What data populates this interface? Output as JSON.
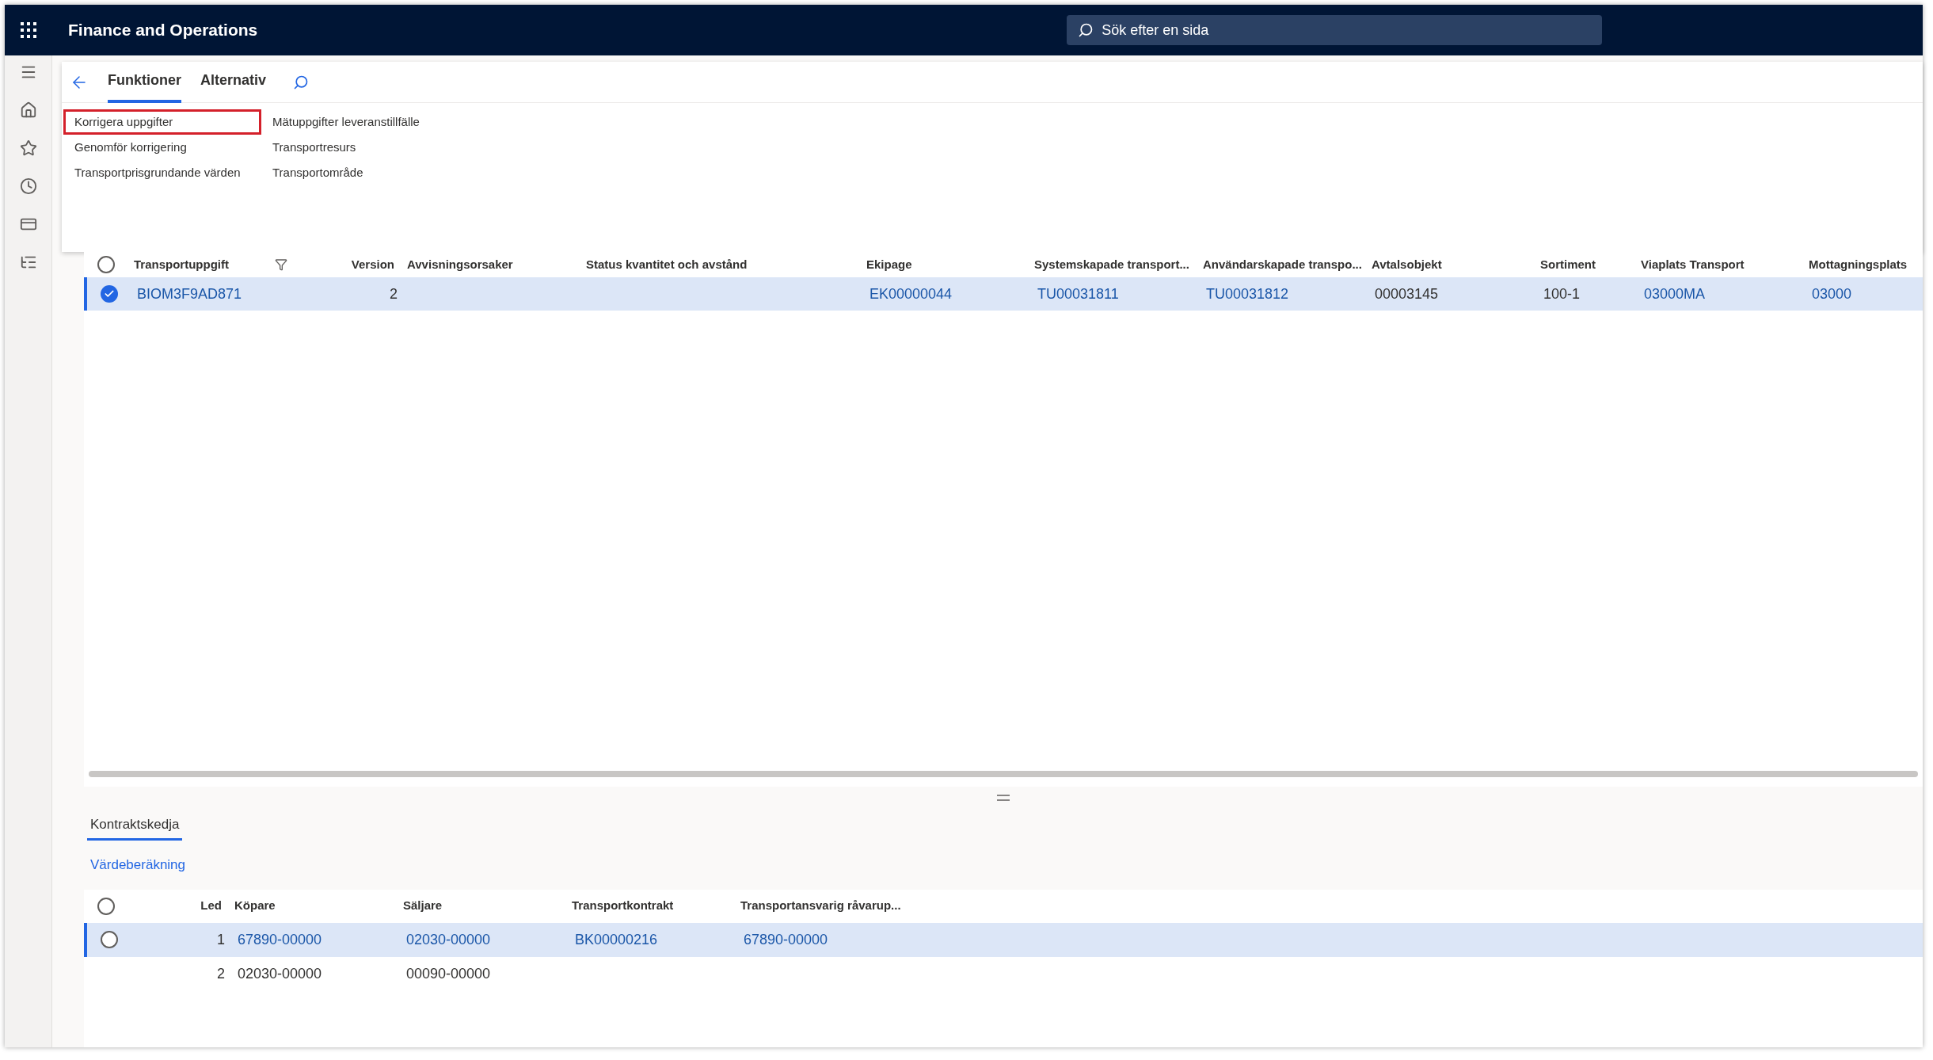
{
  "app": {
    "title": "Finance and Operations",
    "search": {
      "placeholder": "Sök efter en sida"
    }
  },
  "action_pane": {
    "tabs": [
      {
        "label": "Funktioner",
        "selected": true
      },
      {
        "label": "Alternativ",
        "selected": false
      }
    ],
    "groups": [
      [
        {
          "label": "Korrigera uppgifter",
          "highlighted": true
        },
        {
          "label": "Genomför korrigering",
          "highlighted": false
        },
        {
          "label": "Transportprisgrundande värden",
          "highlighted": false
        }
      ],
      [
        {
          "label": "Mätuppgifter leveranstillfälle",
          "highlighted": false
        },
        {
          "label": "Transportresurs",
          "highlighted": false
        },
        {
          "label": "Transportområde",
          "highlighted": false
        }
      ]
    ]
  },
  "grid": {
    "columns": [
      {
        "label": "Transportuppgift",
        "filtered": true
      },
      {
        "label": "Version",
        "filtered": false
      },
      {
        "label": "Avvisningsorsaker",
        "filtered": false
      },
      {
        "label": "Status kvantitet och avstånd",
        "filtered": false
      },
      {
        "label": "Ekipage",
        "filtered": false
      },
      {
        "label": "Systemskapade transport...",
        "filtered": false
      },
      {
        "label": "Användarskapade transpo...",
        "filtered": false
      },
      {
        "label": "Avtalsobjekt",
        "filtered": false
      },
      {
        "label": "Sortiment",
        "filtered": false
      },
      {
        "label": "Viaplats Transport",
        "filtered": false
      },
      {
        "label": "Mottagningsplats",
        "filtered": false
      }
    ],
    "rows": [
      {
        "selected": true,
        "checked": true,
        "cells": [
          {
            "text": "BIOM3F9AD871",
            "kind": "link"
          },
          {
            "text": "2",
            "kind": "number"
          },
          null,
          null,
          {
            "text": "EK00000044",
            "kind": "link"
          },
          {
            "text": "TU00031811",
            "kind": "link"
          },
          {
            "text": "TU00031812",
            "kind": "link"
          },
          {
            "text": "00003145",
            "kind": "text"
          },
          {
            "text": "100-1",
            "kind": "text"
          },
          {
            "text": "03000MA",
            "kind": "link"
          },
          {
            "text": "03000",
            "kind": "link"
          }
        ]
      }
    ]
  },
  "details": {
    "tabs": [
      {
        "label": "Kontraktskedja",
        "selected": true
      }
    ],
    "link": "Värdeberäkning",
    "grid": {
      "columns": [
        {
          "label": "Led"
        },
        {
          "label": "Köpare"
        },
        {
          "label": "Säljare"
        },
        {
          "label": "Transportkontrakt"
        },
        {
          "label": "Transportansvarig råvarup..."
        }
      ],
      "rows": [
        {
          "selected": true,
          "cells": [
            {
              "text": "1",
              "kind": "number"
            },
            {
              "text": "67890-00000",
              "kind": "link"
            },
            {
              "text": "02030-00000",
              "kind": "link"
            },
            {
              "text": "BK00000216",
              "kind": "link"
            },
            {
              "text": "67890-00000",
              "kind": "link"
            }
          ]
        },
        {
          "selected": false,
          "cells": [
            {
              "text": "2",
              "kind": "number"
            },
            {
              "text": "02030-00000",
              "kind": "text"
            },
            {
              "text": "00090-00000",
              "kind": "text"
            },
            null,
            null
          ]
        }
      ]
    }
  }
}
